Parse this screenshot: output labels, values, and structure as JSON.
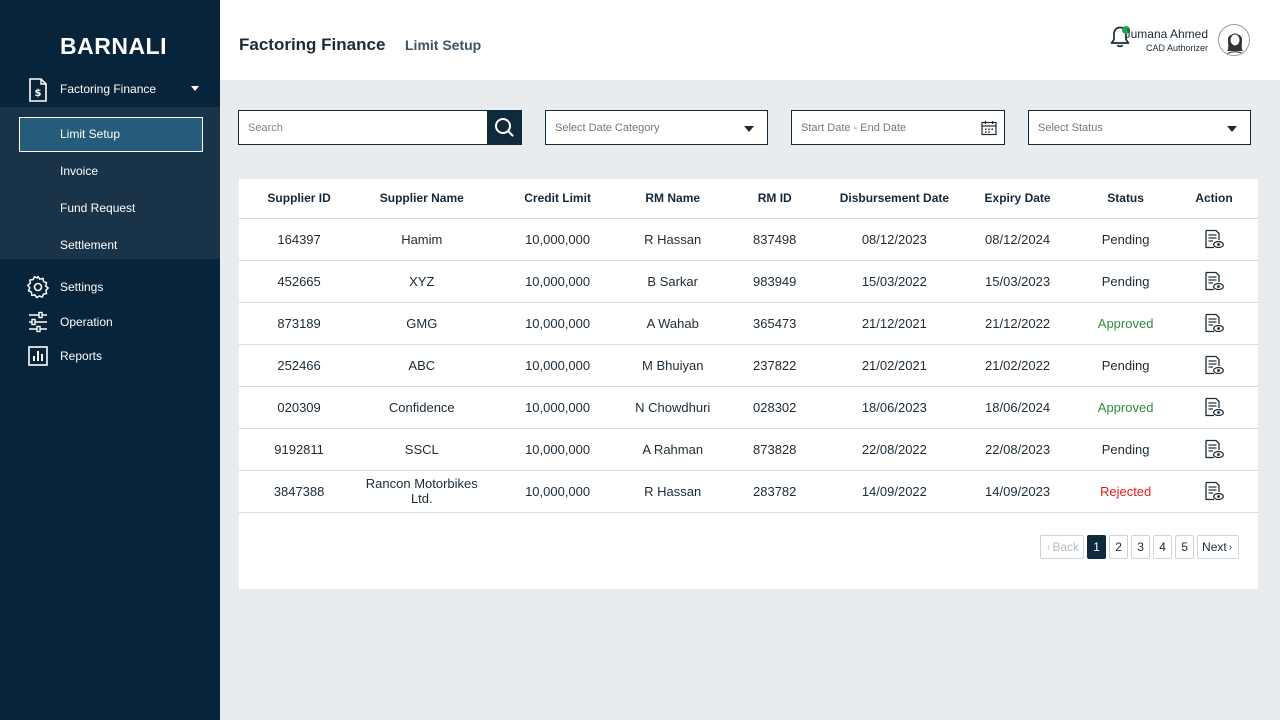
{
  "sidebar": {
    "brand": "BARNALI",
    "section": {
      "label": "Factoring Finance",
      "icon": "document-money-icon"
    },
    "submenu": [
      {
        "label": "Limit Setup",
        "active": true
      },
      {
        "label": "Invoice"
      },
      {
        "label": "Fund Request"
      },
      {
        "label": "Settlement"
      }
    ],
    "nav": [
      {
        "label": "Settings",
        "icon": "gear-icon"
      },
      {
        "label": "Operation",
        "icon": "sliders-icon"
      },
      {
        "label": "Reports",
        "icon": "bar-chart-icon"
      }
    ]
  },
  "header": {
    "title": "Factoring Finance",
    "subtitle": "Limit Setup",
    "user": {
      "name": "Jumana Ahmed",
      "role": "CAD Authorizer"
    }
  },
  "filters": {
    "search_placeholder": "Search",
    "date_category": "Select Date Category",
    "date_range": "Start Date - End Date",
    "status": "Select Status"
  },
  "table": {
    "columns": [
      "Supplier ID",
      "Supplier Name",
      "Credit Limit",
      "RM Name",
      "RM ID",
      "Disbursement Date",
      "Expiry Date",
      "Status",
      "Action"
    ],
    "rows": [
      [
        "164397",
        "Hamim",
        "10,000,000",
        "R Hassan",
        "837498",
        "08/12/2023",
        "08/12/2024",
        "Pending"
      ],
      [
        "452665",
        "XYZ",
        "10,000,000",
        "B Sarkar",
        "983949",
        "15/03/2022",
        "15/03/2023",
        "Pending"
      ],
      [
        "873189",
        "GMG",
        "10,000,000",
        "A Wahab",
        "365473",
        "21/12/2021",
        "21/12/2022",
        "Approved"
      ],
      [
        "252466",
        "ABC",
        "10,000,000",
        "M Bhuiyan",
        "237822",
        "21/02/2021",
        "21/02/2022",
        "Pending"
      ],
      [
        "020309",
        "Confidence",
        "10,000,000",
        "N Chowdhuri",
        "028302",
        "18/06/2023",
        "18/06/2024",
        "Approved"
      ],
      [
        "9192811",
        "SSCL",
        "10,000,000",
        "A Rahman",
        "873828",
        "22/08/2022",
        "22/08/2023",
        "Pending"
      ],
      [
        "3847388",
        "Rancon Motorbikes Ltd.",
        "10,000,000",
        "R Hassan",
        "283782",
        "14/09/2022",
        "14/09/2023",
        "Rejected"
      ]
    ]
  },
  "pagination": {
    "back": "Back",
    "pages": [
      "1",
      "2",
      "3",
      "4",
      "5"
    ],
    "current": "1",
    "next": "Next"
  },
  "colors": {
    "sidebar_bg": "#08243a",
    "submenu_bg": "#193449",
    "active_item_bg": "#255c79",
    "approved": "#2e8b3e",
    "rejected": "#e01e1e",
    "notification_dot": "#1fa34a"
  }
}
